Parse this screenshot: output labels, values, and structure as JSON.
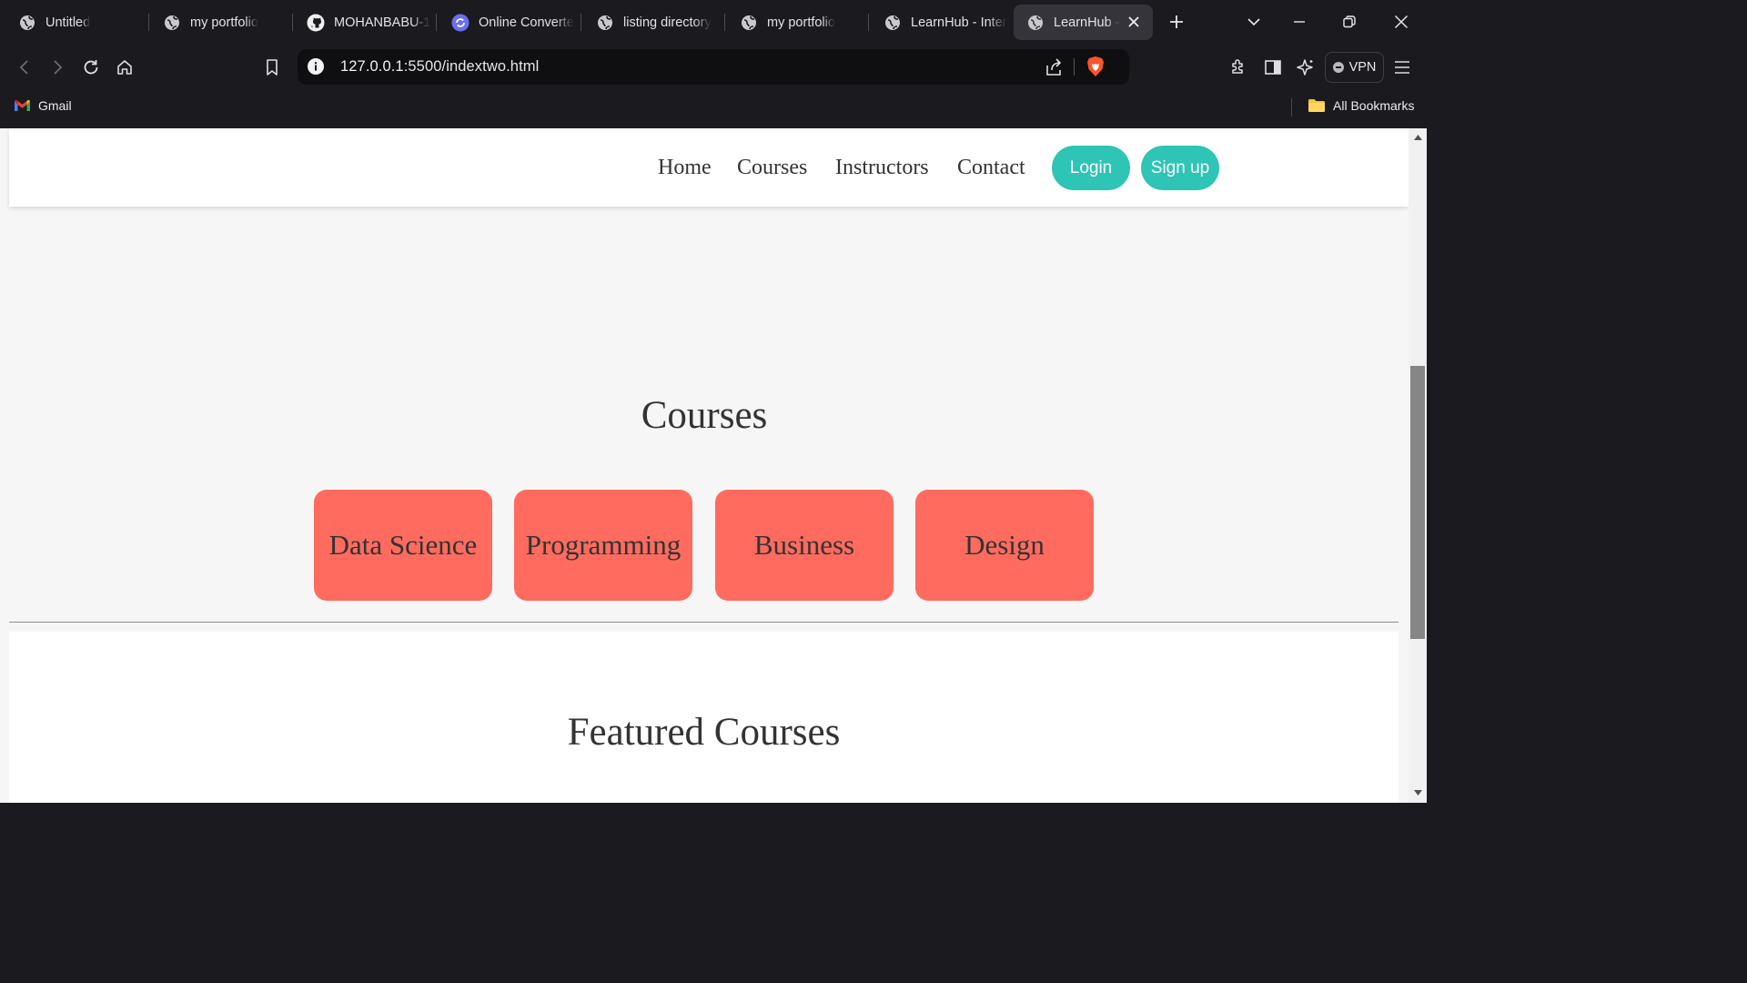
{
  "browser": {
    "tabs": [
      {
        "title": "Untitled",
        "icon": "globe-icon",
        "active": false
      },
      {
        "title": "my portfolio",
        "icon": "globe-icon",
        "active": false
      },
      {
        "title": "MOHANBABU-1",
        "icon": "github-icon",
        "active": false
      },
      {
        "title": "Online Converte",
        "icon": "converter-icon",
        "active": false
      },
      {
        "title": "listing directory",
        "icon": "globe-icon",
        "active": false
      },
      {
        "title": "my portfolio",
        "icon": "globe-icon",
        "active": false
      },
      {
        "title": "LearnHub - Inter",
        "icon": "globe-icon",
        "active": false
      },
      {
        "title": "LearnHub -",
        "icon": "globe-icon",
        "active": true
      }
    ],
    "url": {
      "host": "127.0.0.1",
      "rest": ":5500/indextwo.html"
    },
    "vpn_label": "VPN",
    "bookmarks": {
      "gmail": "Gmail",
      "all": "All Bookmarks"
    },
    "colors": {
      "chrome_bg": "#1b1b1f",
      "active_tab": "#34343a",
      "omnibox": "#0f0f12",
      "brave_orange": "#fb542b"
    }
  },
  "page": {
    "nav": {
      "links": [
        "Home",
        "Courses",
        "Instructors",
        "Contact"
      ],
      "login": "Login",
      "signup": "Sign up"
    },
    "courses_title": "Courses",
    "course_cards": [
      "Data Science",
      "Programming",
      "Business",
      "Design"
    ],
    "featured_title": "Featured Courses",
    "colors": {
      "accent": "#2ec4b6",
      "card": "#ff6b5f",
      "text": "#333333",
      "background": "#f6f6f6"
    }
  }
}
